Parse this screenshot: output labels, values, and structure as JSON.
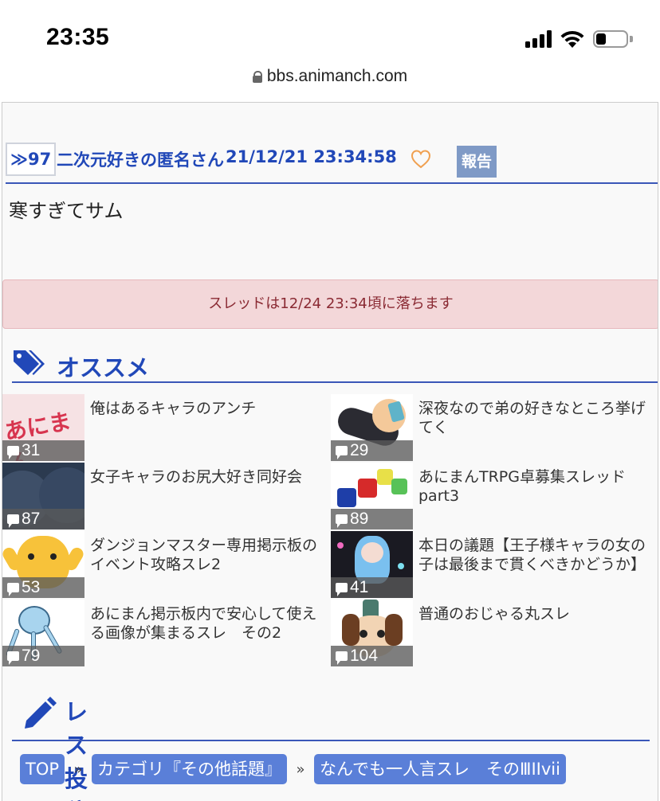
{
  "status_bar": {
    "time": "23:35"
  },
  "browser": {
    "url": "bbs.animanch.com"
  },
  "response": {
    "number": "≫97",
    "author": "二次元好きの匿名さん",
    "datetime": "21/12/21 23:34:58",
    "report_label": "報告",
    "body": "寒すぎてサム"
  },
  "notice": "スレッドは12/24 23:34頃に落ちます",
  "recommend": {
    "title": "オススメ",
    "items": [
      {
        "title": "俺はあるキャラのアンチ",
        "count": "31"
      },
      {
        "title": "深夜なので弟の好きなところ挙げてく",
        "count": "29"
      },
      {
        "title": "女子キャラのお尻大好き同好会",
        "count": "87"
      },
      {
        "title": "あにまんTRPG卓募集スレッドpart3",
        "count": "89"
      },
      {
        "title": "ダンジョンマスター専用掲示板のイベント攻略スレ2",
        "count": "53"
      },
      {
        "title": "本日の議題【王子様キャラの女の子は最後まで貫くべきかどうか】",
        "count": "41"
      },
      {
        "title": "あにまん掲示板内で安心して使える画像が集まるスレ　その2",
        "count": "79"
      },
      {
        "title": "普通のおじゃる丸スレ",
        "count": "104"
      }
    ]
  },
  "post": {
    "title": "レス投稿"
  },
  "breadcrumbs": {
    "items": [
      "TOP",
      "カテゴリ『その他話題』",
      "なんでも一人言スレ　そのⅢⅠⅠvii"
    ],
    "separator": "»"
  },
  "colors": {
    "accent": "#2148b8",
    "crumb": "#5a7fd8",
    "notice_bg": "#f3d7d9",
    "notice_text": "#8a2a33",
    "report": "#7f9ac6"
  }
}
